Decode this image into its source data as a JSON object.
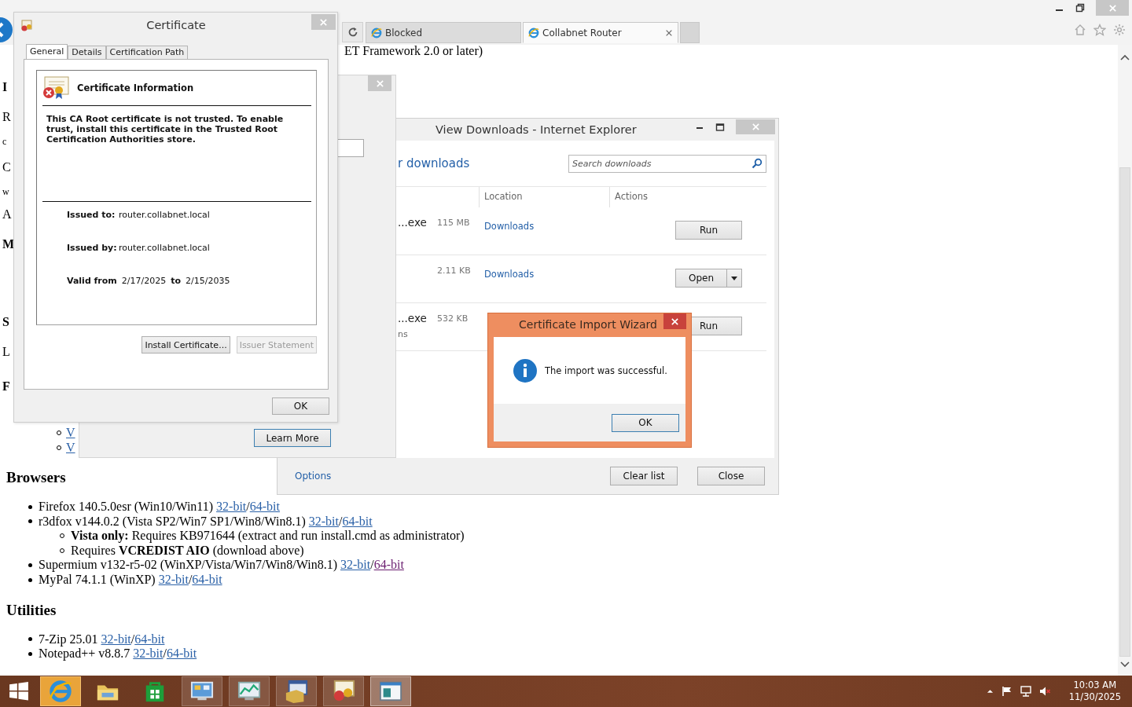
{
  "browser": {
    "tabs": [
      {
        "label": "Blocked",
        "selected": false
      },
      {
        "label": "Collabnet Router",
        "selected": true
      }
    ]
  },
  "page": {
    "top_line": "ET Framework 2.0 or later)",
    "fragments": [
      {
        "kind": "heading",
        "text": "I"
      },
      {
        "kind": "text",
        "text": "R"
      },
      {
        "kind": "small",
        "text": "c"
      },
      {
        "kind": "text",
        "text": "C"
      },
      {
        "kind": "small",
        "text": "w"
      },
      {
        "kind": "text",
        "text": "A"
      },
      {
        "kind": "heading",
        "text": "M"
      },
      {
        "kind": "heading",
        "text": "S"
      },
      {
        "kind": "text",
        "text": "L"
      },
      {
        "kind": "heading",
        "text": "F"
      },
      {
        "kind": "sublink",
        "text": "V"
      },
      {
        "kind": "sublink",
        "text": "V"
      }
    ],
    "link_separator": "/",
    "sections": [
      {
        "heading": "Browsers",
        "items": [
          {
            "text": "Firefox 140.5.0esr (Win10/Win11)",
            "links": [
              {
                "label": "32-bit",
                "visited": false
              },
              {
                "label": "64-bit",
                "visited": false
              }
            ]
          },
          {
            "text": "r3dfox v144.0.2 (Vista SP2/Win7 SP1/Win8/Win8.1)",
            "links": [
              {
                "label": "32-bit",
                "visited": false
              },
              {
                "label": "64-bit",
                "visited": false
              }
            ],
            "children": [
              {
                "text": "**Vista only:** Requires KB971644 (extract and run install.cmd as administrator)"
              },
              {
                "text": "Requires **VCREDIST AIO** (download above)"
              }
            ]
          },
          {
            "text": "Supermium v132-r5-02 (WinXP/Vista/Win7/Win8/Win8.1)",
            "links": [
              {
                "label": "32-bit",
                "visited": false
              },
              {
                "label": "64-bit",
                "visited": true
              }
            ]
          },
          {
            "text": "MyPal 74.1.1 (WinXP)",
            "links": [
              {
                "label": "32-bit",
                "visited": false
              },
              {
                "label": "64-bit",
                "visited": false
              }
            ]
          }
        ]
      },
      {
        "heading": "Utilities",
        "items": [
          {
            "text": "7-Zip 25.01",
            "links": [
              {
                "label": "32-bit",
                "visited": false
              },
              {
                "label": "64-bit",
                "visited": false
              }
            ]
          },
          {
            "text": "Notepad++ v8.8.7",
            "links": [
              {
                "label": "32-bit",
                "visited": false
              },
              {
                "label": "64-bit",
                "visited": false
              }
            ]
          }
        ]
      }
    ]
  },
  "background_dialog": {
    "button": "Learn More"
  },
  "downloads": {
    "title": "View Downloads - Internet Explorer",
    "heading": "r downloads",
    "search_placeholder": "Search downloads",
    "columns": [
      "Location",
      "Actions"
    ],
    "rows": [
      {
        "name": "...exe",
        "size": "115 MB",
        "location": "Downloads",
        "action": "Run",
        "kind": "plain"
      },
      {
        "size": "2.11 KB",
        "location": "Downloads",
        "action": "Open",
        "kind": "split"
      },
      {
        "name": "...exe",
        "note": "ns",
        "size": "532 KB",
        "action": "Run",
        "kind": "plain"
      }
    ],
    "options": "Options",
    "buttons": [
      "Clear list",
      "Close"
    ]
  },
  "certificate_dialog": {
    "title": "Certificate",
    "tabs": [
      {
        "label": "General",
        "selected": true
      },
      {
        "label": "Details",
        "selected": false
      },
      {
        "label": "Certification Path",
        "selected": false
      }
    ],
    "heading": "Certificate Information",
    "message": "This CA Root certificate is not trusted. To enable trust, install this certificate in the Trusted Root Certification Authorities store.",
    "fields": [
      {
        "label": "Issued to:",
        "value": "router.collabnet.local"
      },
      {
        "label": "Issued by:",
        "value": "router.collabnet.local"
      }
    ],
    "validity": {
      "label": "Valid from",
      "from": "2/17/2025",
      "to_label": "to",
      "to": "2/15/2035"
    },
    "buttons": [
      {
        "label": "Install Certificate...",
        "disabled": false
      },
      {
        "label": "Issuer Statement",
        "disabled": true
      }
    ],
    "ok": "OK"
  },
  "wizard": {
    "title": "Certificate Import Wizard",
    "message": "The import was successful.",
    "ok": "OK"
  },
  "taskbar": {
    "apps": [
      {
        "kind": "browser",
        "running": true,
        "selected": false,
        "flashing": true
      },
      {
        "kind": "folder",
        "running": false,
        "selected": false,
        "flashing": false
      },
      {
        "kind": "store",
        "running": false,
        "selected": false,
        "flashing": false
      },
      {
        "kind": "control",
        "running": true,
        "selected": false,
        "flashing": false
      },
      {
        "kind": "monitor",
        "running": true,
        "selected": false,
        "flashing": false
      },
      {
        "kind": "installer",
        "running": true,
        "selected": false,
        "flashing": false
      },
      {
        "kind": "certificate",
        "running": true,
        "selected": false,
        "flashing": false
      },
      {
        "kind": "window",
        "running": true,
        "selected": true,
        "flashing": false
      }
    ],
    "time": "10:03 AM",
    "date": "11/30/2025"
  }
}
